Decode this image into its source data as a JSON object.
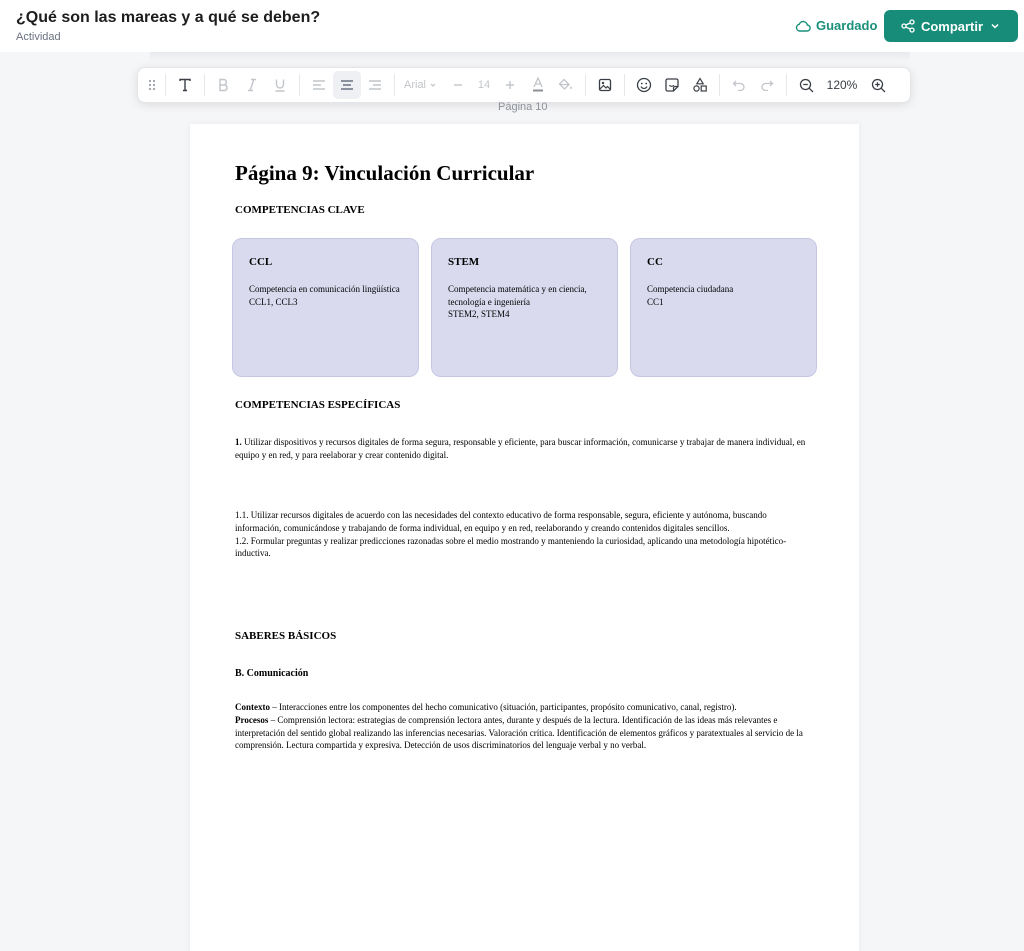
{
  "header": {
    "title": "¿Qué son las mareas y a qué se deben?",
    "subtitle": "Actividad",
    "saved_label": "Guardado",
    "share_label": "Compartir"
  },
  "toolbar": {
    "font_name": "Arial",
    "font_size": "14",
    "zoom": "120%"
  },
  "page_label": "Página 10",
  "document": {
    "heading": "Página 9: Vinculación Curricular",
    "key_competencies_title": "COMPETENCIAS CLAVE",
    "cards": [
      {
        "title": "CCL",
        "desc": "Competencia en comunicación lingüística",
        "codes": "CCL1, CCL3"
      },
      {
        "title": "STEM",
        "desc": "Competencia matemática y en ciencia, tecnología e ingeniería",
        "codes": "STEM2, STEM4"
      },
      {
        "title": "CC",
        "desc": "Competencia ciudadana",
        "codes": "CC1"
      }
    ],
    "specific_title": "COMPETENCIAS ESPECÍFICAS",
    "specific_num": "1.",
    "specific_text": "Utilizar dispositivos y recursos digitales de forma segura, responsable y eficiente, para buscar información, comunicarse y trabajar de manera individual, en equipo y en red, y para reelaborar y crear contenido digital.",
    "criteria_1": "1.1. Utilizar recursos digitales de acuerdo con las necesidades del contexto educativo de forma responsable, segura, eficiente y autónoma, buscando información, comunicándose y trabajando de forma individual, en equipo y en red, reelaborando y creando contenidos digitales sencillos.",
    "criteria_2": "1.2. Formular preguntas y realizar predicciones razonadas sobre el medio mostrando y manteniendo la curiosidad, aplicando una metodología hipotético-inductiva.",
    "basic_title": "SABERES BÁSICOS",
    "block_title": "B. Comunicación",
    "context_label": "Contexto",
    "context_text": " – Interacciones entre los componentes del hecho comunicativo (situación, participantes, propósito comunicativo, canal, registro).",
    "process_label": "Procesos",
    "process_text": " – Comprensión lectora: estrategias de comprensión lectora antes, durante y después de la lectura. Identificación de las ideas más relevantes e interpretación del sentido global realizando las inferencias necesarias. Valoración crítica. Identificación de elementos gráficos y paratextuales al servicio de la comprensión. Lectura compartida y expresiva. Detección de usos discriminatorios del lenguaje verbal y no verbal."
  },
  "colors": {
    "accent": "#178d79",
    "card_bg": "#d9daee"
  }
}
